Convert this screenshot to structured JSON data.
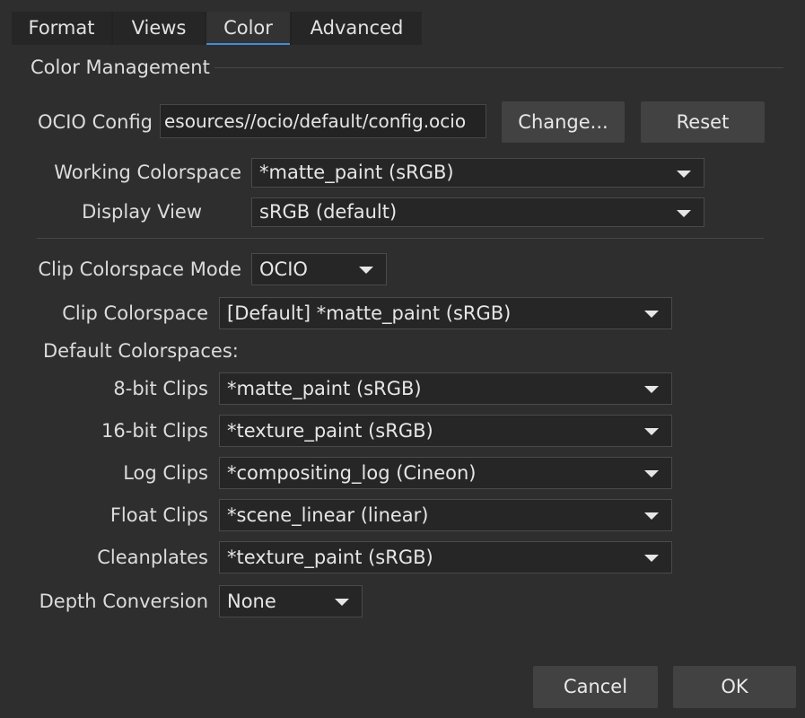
{
  "tabs": [
    {
      "label": "Format"
    },
    {
      "label": "Views"
    },
    {
      "label": "Color"
    },
    {
      "label": "Advanced"
    }
  ],
  "active_tab": "Color",
  "accent_color": "#3e8fd6",
  "section": {
    "title": "Color Management"
  },
  "ocio": {
    "label": "OCIO Config",
    "path": "esources//ocio/default/config.ocio",
    "change_label": "Change...",
    "reset_label": "Reset"
  },
  "working": {
    "label": "Working Colorspace",
    "value": "*matte_paint (sRGB)"
  },
  "display": {
    "label": "Display View",
    "value": "sRGB (default)"
  },
  "clip_mode": {
    "label": "Clip Colorspace Mode",
    "value": "OCIO"
  },
  "clip_cs": {
    "label": "Clip Colorspace",
    "value": "[Default] *matte_paint (sRGB)"
  },
  "defaults": {
    "heading": "Default Colorspaces:",
    "bit8": {
      "label": "8-bit Clips",
      "value": "*matte_paint (sRGB)"
    },
    "bit16": {
      "label": "16-bit Clips",
      "value": "*texture_paint (sRGB)"
    },
    "log": {
      "label": "Log Clips",
      "value": "*compositing_log (Cineon)"
    },
    "float": {
      "label": "Float Clips",
      "value": "*scene_linear (linear)"
    },
    "clean": {
      "label": "Cleanplates",
      "value": "*texture_paint (sRGB)"
    }
  },
  "depth": {
    "label": "Depth Conversion",
    "value": "None"
  },
  "footer": {
    "cancel_label": "Cancel",
    "ok_label": "OK"
  }
}
